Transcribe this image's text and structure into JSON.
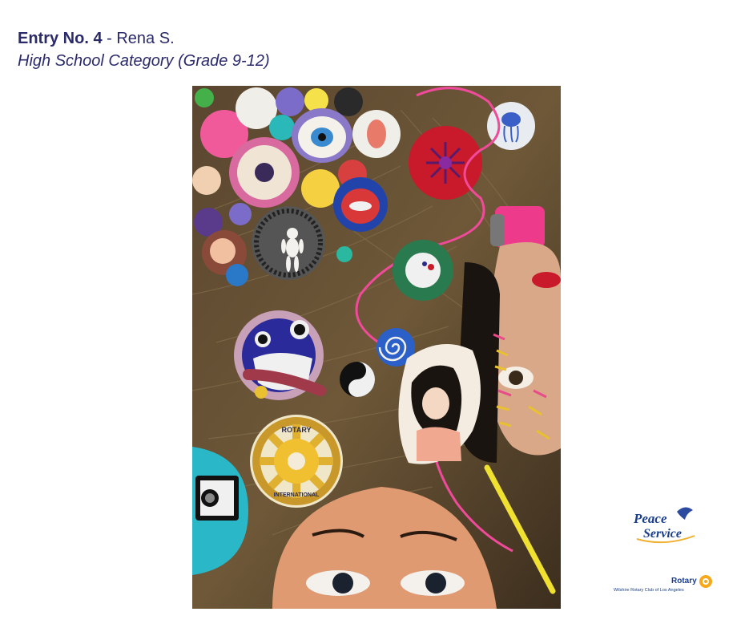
{
  "header": {
    "entry_label": "Entry No. 4",
    "separator": " - ",
    "artist": "Rena S.",
    "category": "High School Category (Grade 9-12)"
  },
  "artwork": {
    "emblem_text_top": "ROTARY",
    "emblem_text_bottom": "INTERNATIONAL"
  },
  "logos": {
    "peace_line1": "Peace",
    "peace_line2": "Service",
    "rotary_word": "Rotary",
    "rotary_club": "Wilshire Rotary Club of Los Angeles"
  },
  "colors": {
    "title_text": "#2b2a6b",
    "rotary_blue": "#1a3e8c",
    "rotary_gold": "#f7a81b"
  }
}
